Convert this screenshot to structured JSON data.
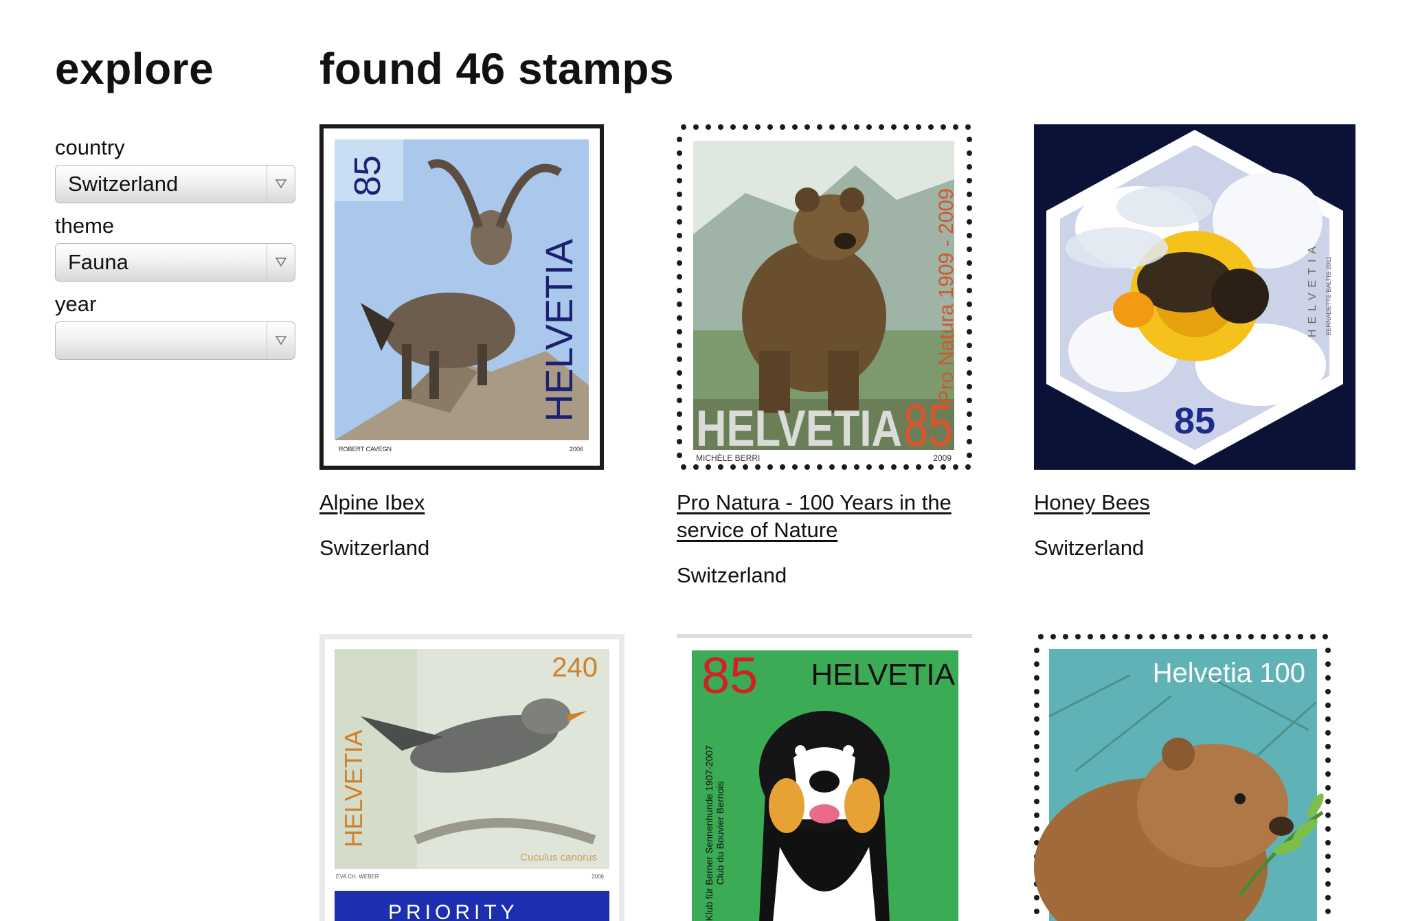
{
  "sidebar": {
    "title": "explore",
    "filters": [
      {
        "label": "country",
        "value": "Switzerland"
      },
      {
        "label": "theme",
        "value": "Fauna"
      },
      {
        "label": "year",
        "value": ""
      }
    ]
  },
  "results": {
    "heading": "found 46 stamps",
    "stamps": [
      {
        "title": "Alpine Ibex",
        "country": "Switzerland",
        "value": "85",
        "brand": "HELVETIA",
        "artist": "ROBERT CAVEGN",
        "year": "2006",
        "subject": "ibex"
      },
      {
        "title": "Pro Natura - 100 Years in the service of Nature",
        "country": "Switzerland",
        "value": "85",
        "brand": "HELVETIA",
        "side_text": "Pro Natura 1909 - 2009",
        "artist": "MICHÈLE BERRI",
        "year": "2009",
        "subject": "bear"
      },
      {
        "title": "Honey Bees",
        "country": "Switzerland",
        "value": "85",
        "brand": "HELVETIA",
        "artist": "BERNADETTE BALTIS 2011",
        "subject": "bee"
      },
      {
        "title": "",
        "country": "",
        "value": "240",
        "brand": "HELVETIA",
        "latin_name": "Cuculus canorus",
        "artist": "EVA CH. WEBER",
        "year": "2006",
        "label": "PRIORITY",
        "subject": "cuckoo"
      },
      {
        "title": "",
        "country": "",
        "value": "85",
        "brand": "HELVETIA",
        "side_text": "Klub für Berner Sennenhunde 1907-2007",
        "side_text_2": "Club du Bouvier Bernois",
        "subject": "dog"
      },
      {
        "title": "",
        "country": "",
        "value": "Helvetia 100",
        "subject": "beaver"
      }
    ]
  },
  "colors": {
    "text": "#111111",
    "ibex_sky": "#a9c8ec",
    "bear_value": "#e0522a",
    "bee_background": "#0b1238",
    "bee_value": "#1d2b8a",
    "cuckoo_value": "#d0802a",
    "priority_band": "#1c2fb0",
    "dog_value": "#d42020",
    "dog_background": "#3bab55",
    "beaver_background": "#5fb3b6"
  }
}
